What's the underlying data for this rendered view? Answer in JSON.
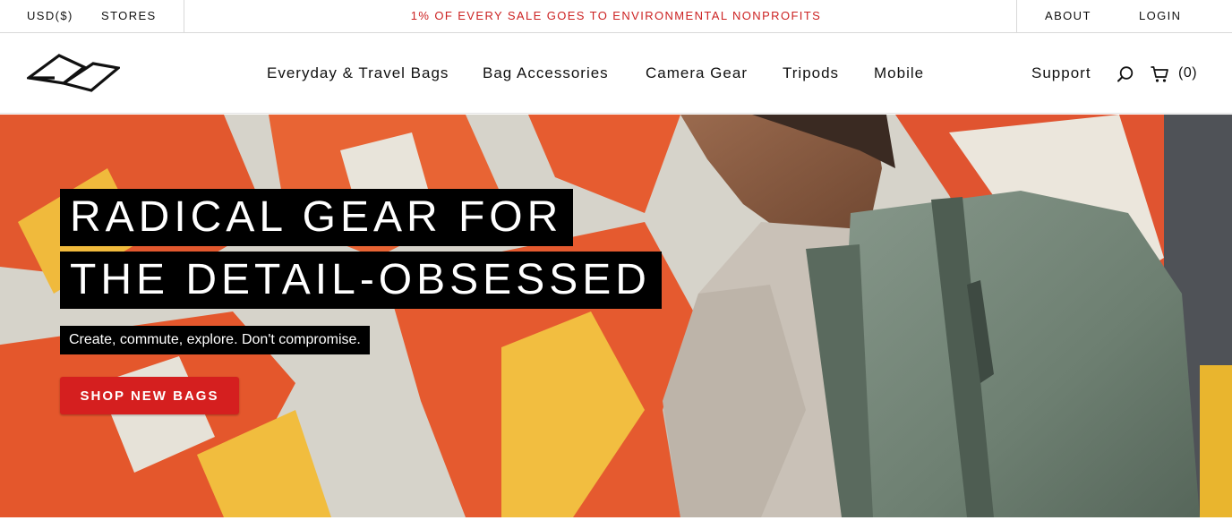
{
  "colors": {
    "promo_red": "#cc2222",
    "cta_red": "#d51f1f",
    "text": "#111111"
  },
  "topbar": {
    "currency": "USD($)",
    "stores": "STORES",
    "promo": "1% OF EVERY SALE GOES TO ENVIRONMENTAL NONPROFITS",
    "about": "ABOUT",
    "login": "LOGIN"
  },
  "nav": {
    "logo_icon": "peak-design-logo",
    "items": [
      {
        "label": "Everyday & Travel Bags"
      },
      {
        "label": "Bag Accessories"
      },
      {
        "label": "Camera Gear"
      },
      {
        "label": "Tripods"
      },
      {
        "label": "Mobile"
      }
    ],
    "support": "Support",
    "search_icon": "search-icon",
    "cart_icon": "cart-icon",
    "cart_count": "(0)"
  },
  "hero": {
    "headline_line1": "RADICAL GEAR FOR",
    "headline_line2": "THE DETAIL-OBSESSED",
    "subheadline": "Create, commute, explore. Don't compromise.",
    "cta_label": "SHOP NEW BAGS",
    "image": "person wearing green backpack in front of orange mural"
  }
}
